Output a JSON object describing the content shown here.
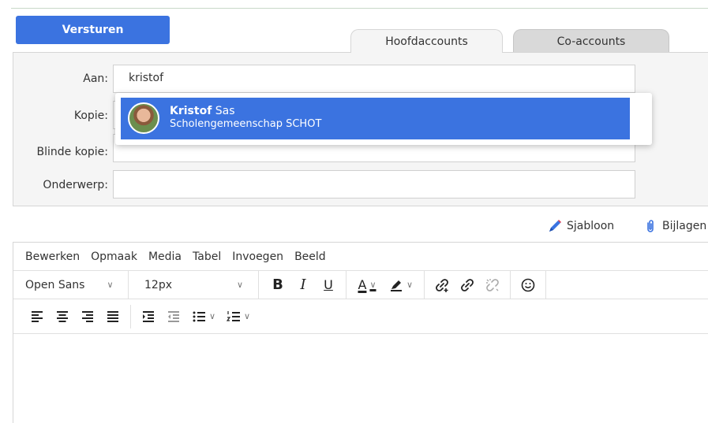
{
  "header": {
    "send_label": "Versturen",
    "tabs": [
      {
        "label": "Hoofdaccounts",
        "active": true
      },
      {
        "label": "Co-accounts",
        "active": false
      }
    ]
  },
  "form": {
    "to_label": "Aan:",
    "to_value": "kristof",
    "cc_label": "Kopie:",
    "bcc_label": "Blinde kopie:",
    "subject_label": "Onderwerp:"
  },
  "autocomplete": {
    "name_bold": "Kristof",
    "name_rest": " Sas",
    "organisation": "Scholengemeenschap SCHOT"
  },
  "actions": {
    "template_label": "Sjabloon",
    "attachments_label": "Bijlagen"
  },
  "editor": {
    "menu": [
      "Bewerken",
      "Opmaak",
      "Media",
      "Tabel",
      "Invoegen",
      "Beeld"
    ],
    "font_family": "Open Sans",
    "font_size": "12px",
    "bold_glyph": "B",
    "italic_glyph": "I",
    "underline_glyph": "U",
    "text_color_glyph": "A"
  },
  "colors": {
    "accent": "#3b73e0",
    "pencil": "#3b73e0",
    "pencil_tip": "#e0334a"
  }
}
